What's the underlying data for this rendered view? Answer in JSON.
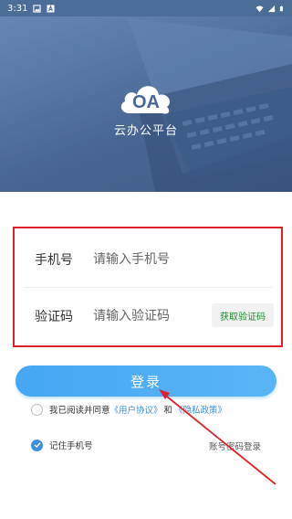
{
  "status_bar": {
    "time": "3:31",
    "icons_left": [
      "image-icon",
      "app-a-icon"
    ],
    "icons_right": [
      "wifi-icon",
      "signal-icon",
      "battery-icon"
    ]
  },
  "header": {
    "app_name": "云办公平台",
    "logo_text": "OA"
  },
  "form": {
    "phone_label": "手机号",
    "phone_placeholder": "请输入手机号",
    "code_label": "验证码",
    "code_placeholder": "请输入验证码",
    "get_code_label": "获取验证码"
  },
  "login_button_label": "登录",
  "agreement": {
    "prefix": "我已阅读并同意",
    "user_agreement": "《用户协议》",
    "and": "和",
    "privacy_policy": "《隐私政策》"
  },
  "remember_label": "记住手机号",
  "password_login_label": "账号密码登录",
  "colors": {
    "accent": "#45a7f2",
    "link": "#3d8fe0",
    "highlight": "#e0202a",
    "get_code": "#1c8a2c"
  }
}
